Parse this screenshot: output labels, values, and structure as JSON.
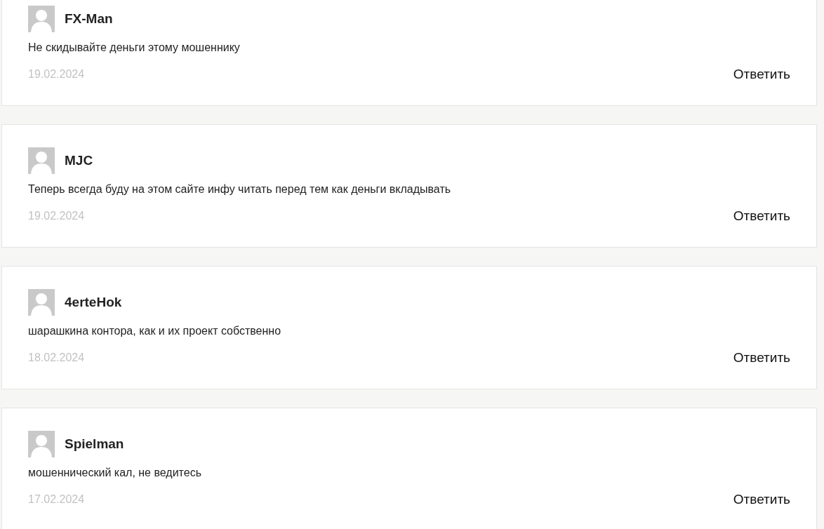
{
  "comments": [
    {
      "author": "FX-Man",
      "text": "Не скидывайте деньги этому мошеннику",
      "date": "19.02.2024",
      "reply": "Ответить"
    },
    {
      "author": "MJC",
      "text": "Теперь всегда буду на этом сайте инфу читать перед тем как деньги вкладывать",
      "date": "19.02.2024",
      "reply": "Ответить"
    },
    {
      "author": "4erteHok",
      "text": "шарашкина контора, как и их проект собственно",
      "date": "18.02.2024",
      "reply": "Ответить"
    },
    {
      "author": "Spielman",
      "text": "мошеннический кал, не ведитесь",
      "date": "17.02.2024",
      "reply": "Ответить"
    }
  ]
}
